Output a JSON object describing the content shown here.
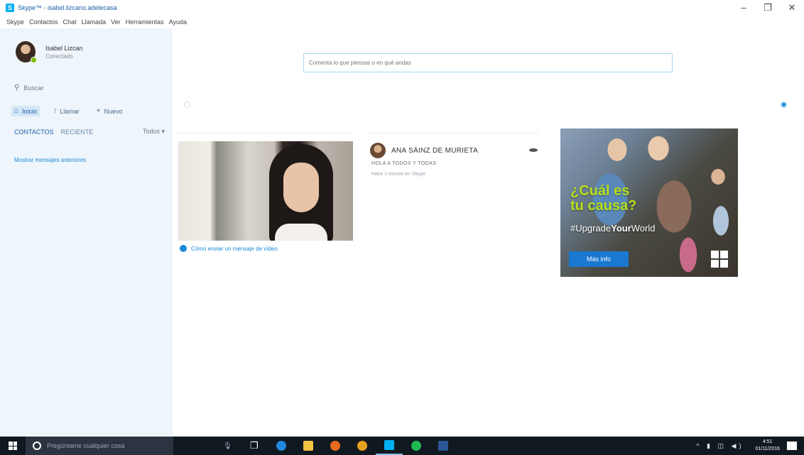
{
  "window": {
    "title": "Skype™ - isabel.lizcano.adelecasa",
    "controls": {
      "minimize": "–",
      "maximize": "❐",
      "close": "✕"
    }
  },
  "menu": [
    "Skype",
    "Contactos",
    "Chat",
    "Llamada",
    "Ver",
    "Herramientas",
    "Ayuda"
  ],
  "profile": {
    "name": "Isabel Lizcan",
    "status": "Conectado"
  },
  "sidebar": {
    "search_label": "Buscar",
    "nav": {
      "home": "Inicio",
      "calls": "Llamar",
      "new": "Nuevo"
    },
    "tabs": {
      "contacts": "CONTACTOS",
      "recent": "RECIENTE",
      "filter": "Todos ▾"
    },
    "older_link": "Mostrar mensajes anteriores"
  },
  "main": {
    "mood_placeholder": "Comenta lo que piensas o en qué andas",
    "video_link": "Cómo enviar un mensaje de vídeo",
    "contact": {
      "name": "ANA SÁINZ DE MURIETA",
      "mood": "HOLA A TODOS Y TODAS",
      "time": "Hace 1 minuto en Skype"
    },
    "ad": {
      "headline_1": "¿Cuál es",
      "headline_2": "tu causa?",
      "hashtag_pre": "#Upgrade",
      "hashtag_bold": "Your",
      "hashtag_post": "World",
      "button": "Más info"
    }
  },
  "taskbar": {
    "search_placeholder": "Pregúntame cualquier cosa",
    "clock_time": "4:51",
    "clock_date": "01/11/2016"
  }
}
